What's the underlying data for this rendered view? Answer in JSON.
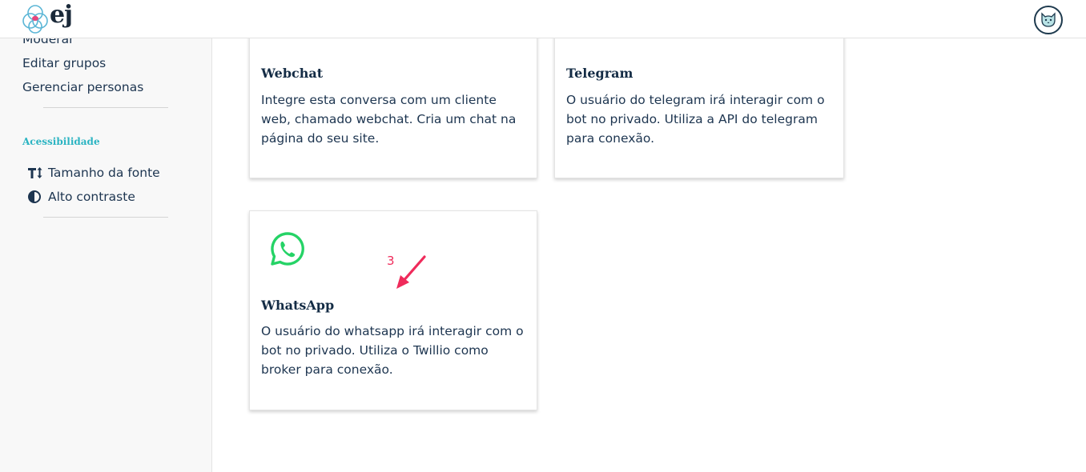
{
  "app": {
    "logo_text": "ej"
  },
  "sidebar": {
    "links": [
      {
        "label": "Moderar"
      },
      {
        "label": "Editar grupos"
      },
      {
        "label": "Gerenciar personas"
      }
    ],
    "accessibility": {
      "title": "Acessibilidade",
      "items": [
        {
          "label": "Tamanho da fonte",
          "icon": "font-size-icon"
        },
        {
          "label": "Alto contraste",
          "icon": "contrast-icon"
        }
      ]
    }
  },
  "cards": [
    {
      "title": "Webchat",
      "description": "Integre esta conversa com um cliente web, chamado webchat. Cria um chat na página do seu site."
    },
    {
      "title": "Telegram",
      "description": "O usuário do telegram irá interagir com o bot no privado. Utiliza a API do telegram para conexão."
    },
    {
      "title": "WhatsApp",
      "description": "O usuário do whatsapp irá interagir com o bot no privado. Utiliza o Twillio como broker para conexão.",
      "icon": "whatsapp-icon"
    }
  ],
  "annotation": {
    "label": "3",
    "color": "#ef2b5b"
  },
  "colors": {
    "accent": "#2bb4c2",
    "whatsapp": "#25d366",
    "text": "#1d3550"
  }
}
